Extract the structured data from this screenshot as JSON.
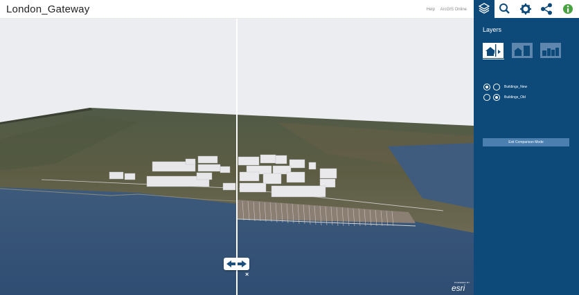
{
  "app": {
    "title": "London_Gateway"
  },
  "header_links": {
    "help": "Help",
    "arcgis": "ArcGIS Online"
  },
  "toolbar": {
    "items": [
      {
        "name": "layers",
        "icon": "layers-icon",
        "active": true
      },
      {
        "name": "search",
        "icon": "search-icon"
      },
      {
        "name": "settings",
        "icon": "gear-icon"
      },
      {
        "name": "share",
        "icon": "share-icon"
      },
      {
        "name": "info",
        "icon": "info-icon"
      }
    ],
    "colors": {
      "active_bg": "#0b3f6a",
      "panel_bg": "#0d4a7a",
      "info_green": "#48a23f"
    }
  },
  "panel": {
    "title": "Layers",
    "thumbnails": [
      {
        "name": "comparison",
        "icon": "house-swipe-icon",
        "selected": true
      },
      {
        "name": "buildings",
        "icon": "buildings-icon"
      },
      {
        "name": "city",
        "icon": "city-icon"
      }
    ],
    "layers": [
      {
        "label": "Buildings_New",
        "left_selected": true,
        "right_selected": false
      },
      {
        "label": "Buildings_Old",
        "left_selected": false,
        "right_selected": true
      }
    ],
    "exit_button": "Exit Comparison Mode"
  },
  "swipe": {
    "close": "×"
  },
  "attribution": {
    "small": "POWERED BY",
    "big": "esri"
  }
}
